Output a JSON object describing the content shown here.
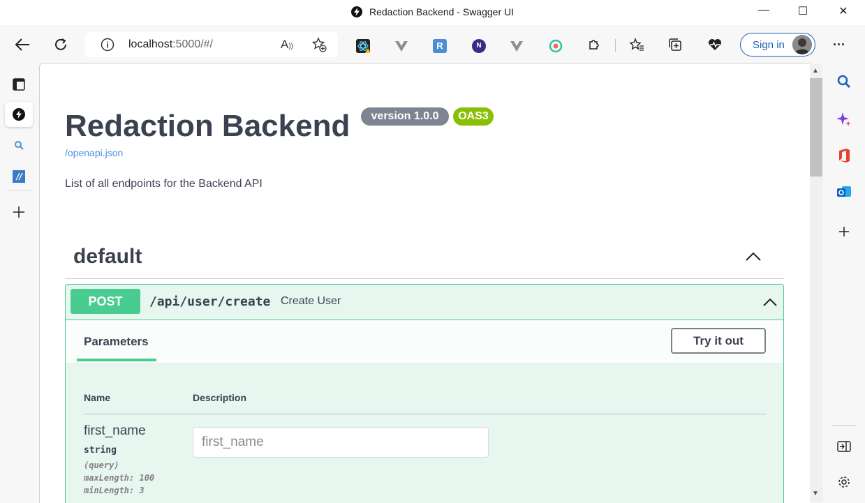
{
  "window": {
    "title": "Redaction Backend - Swagger UI",
    "minimize": "—",
    "maximize": "☐",
    "close": "✕"
  },
  "toolbar": {
    "url_host": "localhost",
    "url_path": ":5000/#/",
    "read_aloud": "A",
    "extension_r": "R",
    "extension_n": "N",
    "signin_label": "Sign in",
    "more": "···"
  },
  "page": {
    "title": "Redaction Backend",
    "version_badge": "version 1.0.0",
    "oas_badge": "OAS3",
    "spec_link": "/openapi.json",
    "description": "List of all endpoints for the Backend API",
    "tag": "default",
    "operation": {
      "method": "POST",
      "path": "/api/user/create",
      "summary": "Create User",
      "parameters_tab": "Parameters",
      "try_label": "Try it out",
      "col_name": "Name",
      "col_description": "Description",
      "param": {
        "name": "first_name",
        "type": "string",
        "location": "(query)",
        "max": "maxLength: 100",
        "min": "minLength: 3",
        "placeholder": "first_name"
      }
    }
  },
  "colors": {
    "post_green": "#49cc90",
    "version_badge": "#7d8492",
    "oas_badge": "#89bf04",
    "link_blue": "#4990e2"
  }
}
